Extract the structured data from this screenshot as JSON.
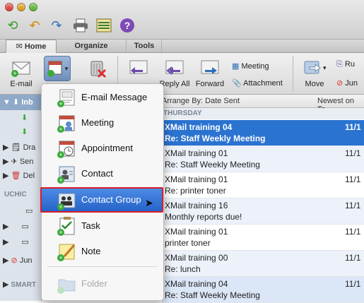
{
  "ribbon_tabs": [
    "Home",
    "Organize",
    "Tools"
  ],
  "ribbon": {
    "email_label": "E-mail",
    "reply_all_label": "Reply All",
    "forward_label": "Forward",
    "meeting_label": "Meeting",
    "attachment_label": "Attachment",
    "move_label": "Move",
    "rules_label": "Ru",
    "junk_label": "Jun"
  },
  "sidebar": {
    "inbox_label": "Inb",
    "drafts_label": "Dra",
    "sent_label": "Sen",
    "deleted_label": "Del",
    "account_header": "UCHIC",
    "junk_label": "Jun",
    "smart_header": "SMART"
  },
  "list": {
    "arrange_label": "Arrange By: Date Sent",
    "sort_label": "Newest on To",
    "group_label": "THURSDAY",
    "messages": [
      {
        "sender": "XMail training 04",
        "subject": "Re: Staff Weekly Meeting",
        "date": "11/1"
      },
      {
        "sender": "XMail training 01",
        "subject": "Re: Staff Weekly Meeting",
        "date": "11/1"
      },
      {
        "sender": "XMail training 01",
        "subject": "Re: printer toner",
        "date": "11/1"
      },
      {
        "sender": "XMail training 16",
        "subject": "Monthly reports due!",
        "date": "11/1"
      },
      {
        "sender": "XMail training 01",
        "subject": "printer toner",
        "date": "11/1"
      },
      {
        "sender": "XMail training 00",
        "subject": "Re: lunch",
        "date": "11/1"
      },
      {
        "sender": "XMail training 04",
        "subject": "Re: Staff Weekly Meeting",
        "date": "11/1"
      }
    ]
  },
  "menu": {
    "items": [
      "E-mail Message",
      "Meeting",
      "Appointment",
      "Contact",
      "Contact Group",
      "Task",
      "Note",
      "Folder"
    ]
  },
  "colors": {
    "selection": "#2b73d0",
    "menu_highlight": "#2563c9",
    "highlight_border": "#d81e2a"
  }
}
